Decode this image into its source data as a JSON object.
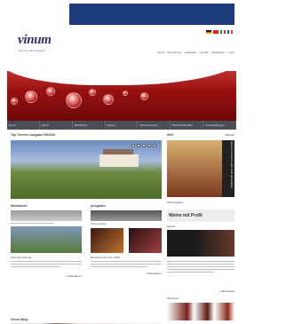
{
  "site": {
    "logo": "vinum",
    "logo_tagline": "Europas Weinmagazin"
  },
  "topnav": [
    "Home",
    "Abo-Service",
    "Newsletter",
    "Kontakt",
    "Mediadaten",
    "Login"
  ],
  "mainnav": [
    "Home",
    "Weine",
    "Weinführer",
    "Reisen",
    "Wissenswertes",
    "Weinfachhändler",
    "Veranstaltungen"
  ],
  "main": {
    "feature_title": "Top Themen Ausgabe 09/2016",
    "col1_title": "Weinländer",
    "col2_title": "Ausgaben",
    "item1_label": "Wein des Monats",
    "item2_label": "Vinum Fokus",
    "item3_label": "Bordeaux Primeurs 2016",
    "more1": "» Weiterlesen",
    "more2": "» Weiterlesen",
    "blog_title": "Vinum Blog"
  },
  "sidebar": {
    "title": "Heft",
    "date": "09/2016",
    "issue_headline": "Vinum im neuen Look! Jetzt abonnieren.",
    "section2": "Weinmagazin",
    "promo": "Weine mit Profil",
    "events_title": "Events",
    "more": "» Alle Events",
    "shop_title": "Weinshop"
  },
  "colors": {
    "topband": "#1d3b7c",
    "hero_red": "#9a1010",
    "nav": "#4a4f57"
  }
}
